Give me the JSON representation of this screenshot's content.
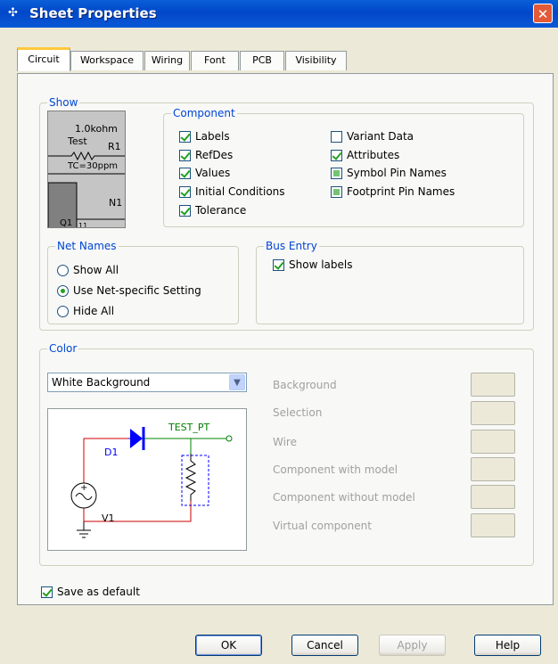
{
  "window": {
    "title": "Sheet Properties",
    "close": "✕"
  },
  "tabs": [
    "Circuit",
    "Workspace",
    "Wiring",
    "Font",
    "PCB",
    "Visibility"
  ],
  "show": {
    "legend": "Show",
    "preview": {
      "value": "1.0kohm",
      "name": "Test",
      "refdes": "R1",
      "tc": "TC=30ppm",
      "net": "N1",
      "q": "Q1",
      "pin": "11"
    },
    "component": {
      "legend": "Component",
      "left": [
        {
          "label": "Labels",
          "state": "checked"
        },
        {
          "label": "RefDes",
          "state": "checked"
        },
        {
          "label": "Values",
          "state": "checked"
        },
        {
          "label": "Initial Conditions",
          "state": "checked"
        },
        {
          "label": "Tolerance",
          "state": "checked"
        }
      ],
      "right": [
        {
          "label": "Variant Data",
          "state": "unchecked"
        },
        {
          "label": "Attributes",
          "state": "checked"
        },
        {
          "label": "Symbol Pin Names",
          "state": "indeterminate"
        },
        {
          "label": "Footprint Pin Names",
          "state": "indeterminate"
        }
      ]
    },
    "net_names": {
      "legend": "Net Names",
      "options": [
        "Show All",
        "Use Net-specific Setting",
        "Hide All"
      ],
      "selected": "Use Net-specific Setting"
    },
    "bus_entry": {
      "legend": "Bus Entry",
      "show_labels": "Show labels",
      "checked": true
    }
  },
  "color": {
    "legend": "Color",
    "scheme": "White Background",
    "items": [
      "Background",
      "Selection",
      "Wire",
      "Component with model",
      "Component without model",
      "Virtual component"
    ],
    "circuit_preview": {
      "diode": "D1",
      "test_point": "TEST_PT",
      "source": "V1"
    },
    "colors": {
      "wire": "#cc0000",
      "component": "#0000ff",
      "label": "#008000"
    }
  },
  "save_default": {
    "label": "Save as default",
    "checked": true
  },
  "buttons": {
    "ok": "OK",
    "cancel": "Cancel",
    "apply": "Apply",
    "help": "Help"
  }
}
